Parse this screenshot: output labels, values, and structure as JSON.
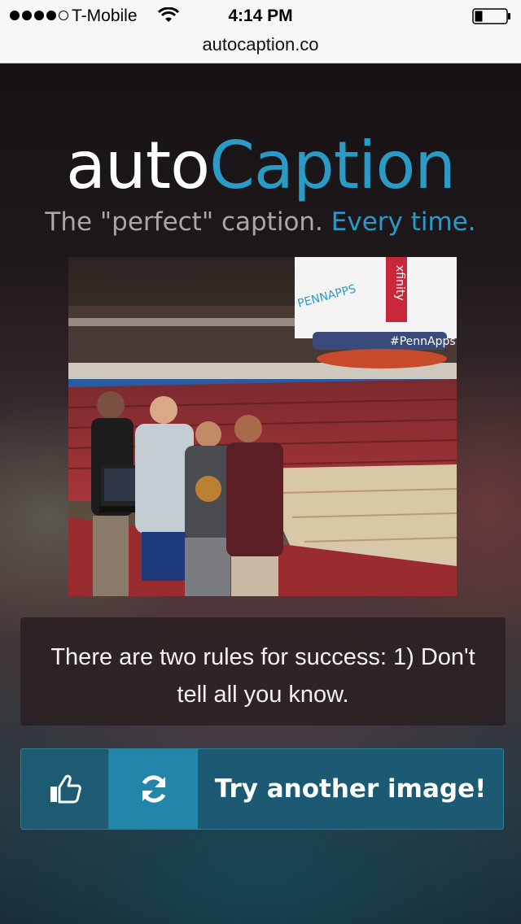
{
  "status_bar": {
    "carrier": "T-Mobile",
    "time": "4:14 PM",
    "signal_bars_filled": 4,
    "signal_bars_total": 5
  },
  "browser": {
    "url": "autocaption.co"
  },
  "brand": {
    "part1": "auto",
    "part2": "Caption"
  },
  "tagline": {
    "part1": "The \"perfect\" caption.",
    "part2": "Every time."
  },
  "caption": {
    "text": "There are two rules for success: 1) Don't tell all you know."
  },
  "actions": {
    "like_icon": "thumbs-up-icon",
    "refresh_icon": "refresh-icon",
    "try_label": "Try another image!"
  },
  "photo": {
    "scoreboard_text": "PENNAPPS",
    "banner_text": "xfinity",
    "hashtag": "#PennApps"
  },
  "colors": {
    "brand_blue": "#2a9bc6",
    "button_dark": "#1b5a72",
    "button_active": "#2286ab"
  }
}
